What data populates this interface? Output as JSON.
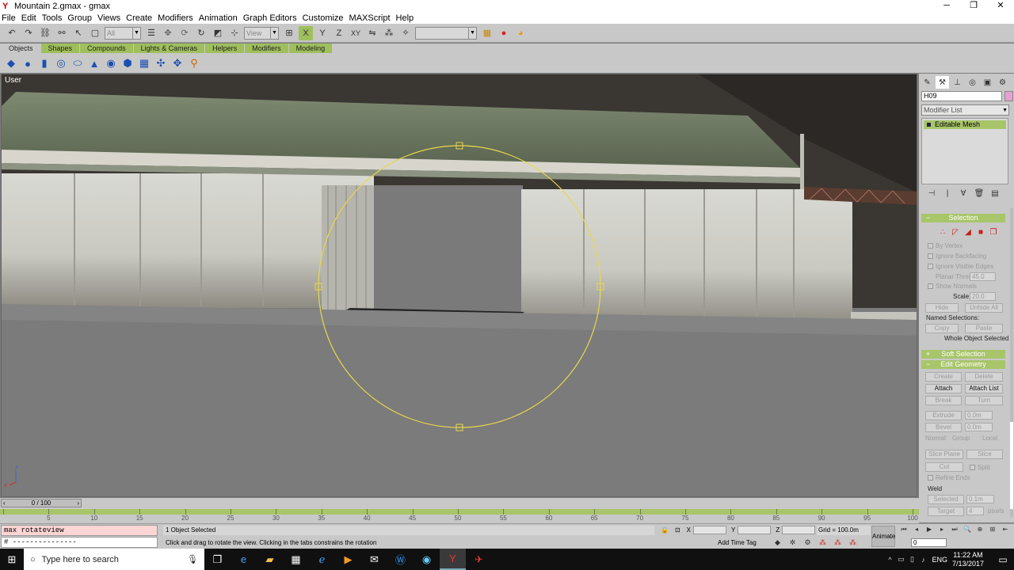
{
  "window": {
    "title": "Mountain 2.gmax - gmax",
    "app_icon": "gmax-icon",
    "controls": [
      "─",
      "❐",
      "✕"
    ]
  },
  "menu": [
    "File",
    "Edit",
    "Tools",
    "Group",
    "Views",
    "Create",
    "Modifiers",
    "Animation",
    "Graph Editors",
    "Customize",
    "MAXScript",
    "Help"
  ],
  "toolbar": {
    "selection_filter": "All",
    "ref_coord": "View",
    "named_selection": ""
  },
  "tabs": [
    "Objects",
    "Shapes",
    "Compounds",
    "Lights & Cameras",
    "Helpers",
    "Modifiers",
    "Modeling"
  ],
  "active_tab": "Objects",
  "viewport": {
    "label": "User",
    "axis_z": "z",
    "axis_x": "x"
  },
  "command_panel": {
    "object_name": "H09",
    "object_color": "#e8a0d0",
    "modifier_list": "Modifier List",
    "stack": [
      "Editable Mesh"
    ],
    "selection": {
      "header": "Selection",
      "by_vertex": "By Vertex",
      "ignore_backfacing": "Ignore Backfacing",
      "ignore_visible_edges": "Ignore Visible Edges",
      "planar_thresh_label": "Planar Thresh:",
      "planar_thresh": "45.0",
      "show_normals": "Show Normals",
      "scale_label": "Scale:",
      "scale": "20.0",
      "hide": "Hide",
      "unhide_all": "Unhide All",
      "named_selections": "Named Selections:",
      "copy": "Copy",
      "paste": "Paste",
      "status": "Whole Object Selected"
    },
    "soft_selection": {
      "header": "Soft Selection"
    },
    "edit_geometry": {
      "header": "Edit Geometry",
      "create": "Create",
      "delete": "Delete",
      "attach": "Attach",
      "attach_list": "Attach List",
      "break": "Break",
      "turn": "Turn",
      "extrude": "Extrude",
      "extrude_val": "0.0m",
      "bevel": "Bevel",
      "bevel_val": "0.0m",
      "normal": "Normal:",
      "group": "Group",
      "local": "Local",
      "slice_plane": "Slice Plane",
      "slice": "Slice",
      "cut": "Cut",
      "split": "Split",
      "refine_ends": "Refine Ends",
      "weld": "Weld",
      "selected": "Selected",
      "selected_val": "0.1m",
      "target": "Target",
      "target_val": "4",
      "pixels": "pixels"
    }
  },
  "time": {
    "slider": "0 / 100",
    "ticks": [
      0,
      5,
      10,
      15,
      20,
      25,
      30,
      35,
      40,
      45,
      50,
      55,
      60,
      65,
      70,
      75,
      80,
      85,
      90,
      95,
      100
    ]
  },
  "status": {
    "listener_line1": "max rotateview",
    "listener_line2": "# ---------------",
    "selection_count": "1 Object Selected",
    "prompt": "Click and drag to rotate the view.  Clicking in the tabs constrains the rotation",
    "x_label": "X",
    "y_label": "Y",
    "z_label": "Z",
    "grid": "Grid = 100.0m",
    "add_time_tag": "Add Time Tag",
    "animate": "Animate",
    "frame": "0"
  },
  "taskbar": {
    "search_placeholder": "Type here to search",
    "apps": [
      "task-view-icon",
      "edge-icon",
      "file-explorer-icon",
      "store-icon",
      "ie-icon",
      "media-icon",
      "mail-icon",
      "wunderlist-icon",
      "aol-icon",
      "gmax-icon",
      "flight-sim-icon"
    ],
    "tray_lang": "ENG",
    "time": "11:22 AM",
    "date": "7/13/2017"
  }
}
